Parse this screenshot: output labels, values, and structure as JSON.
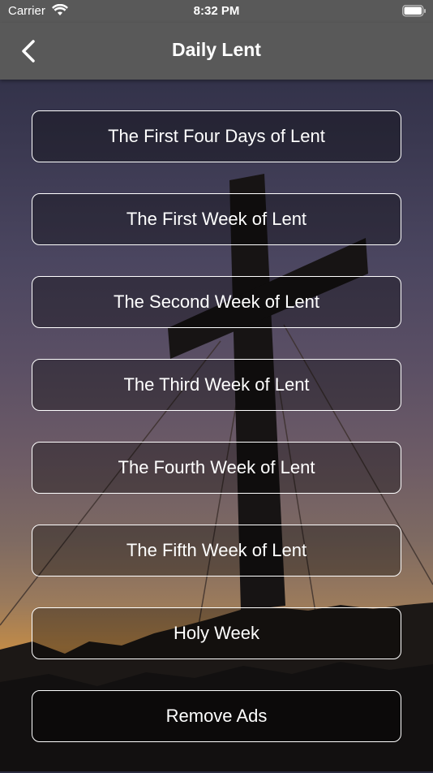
{
  "status_bar": {
    "carrier": "Carrier",
    "time": "8:32 PM",
    "wifi_icon": "wifi-icon",
    "battery_icon": "battery-icon"
  },
  "nav_bar": {
    "title": "Daily Lent",
    "back_icon": "chevron-left-icon",
    "background_color": "#595959"
  },
  "menu": {
    "items": [
      {
        "label": "The First Four Days of Lent"
      },
      {
        "label": "The First Week of Lent"
      },
      {
        "label": "The Second Week of Lent"
      },
      {
        "label": "The Third Week of Lent"
      },
      {
        "label": "The Fourth Week of Lent"
      },
      {
        "label": "The Fifth Week of Lent"
      },
      {
        "label": "Holy Week"
      },
      {
        "label": "Remove Ads"
      }
    ]
  },
  "background": {
    "description_icon": "cross-silhouette-sunset-image"
  }
}
